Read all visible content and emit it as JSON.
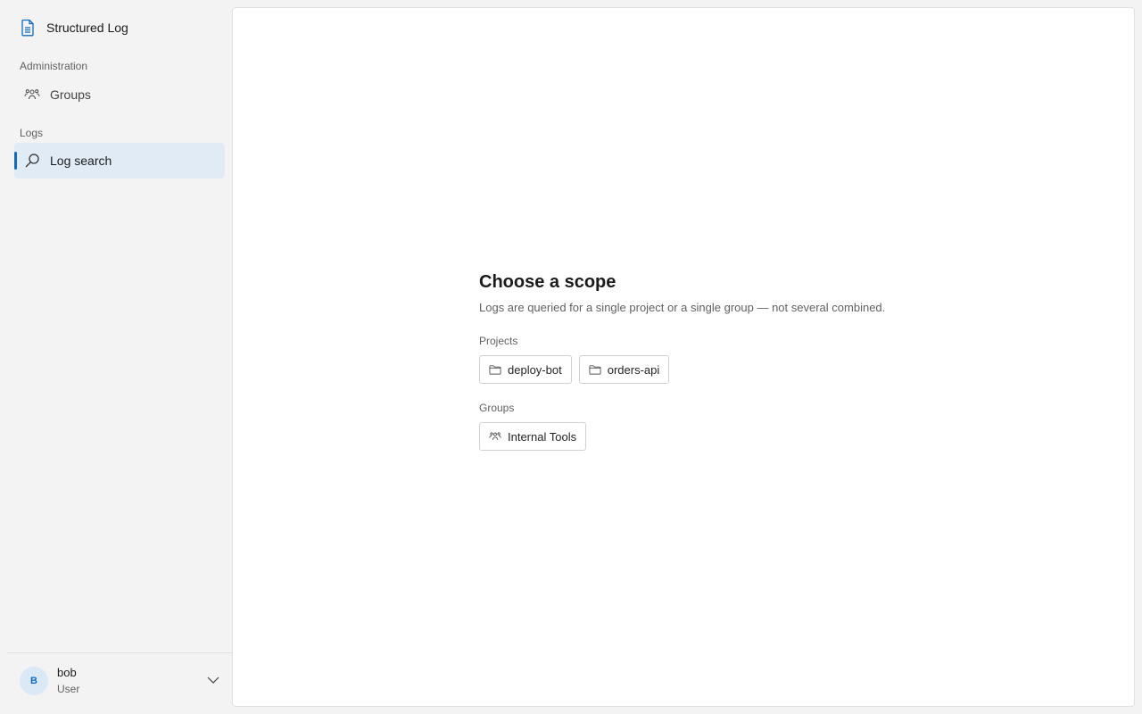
{
  "sidebar": {
    "brand": {
      "title": "Structured Log",
      "icon": "document-icon"
    },
    "sections": [
      {
        "label": "Administration",
        "items": [
          {
            "label": "Groups",
            "icon": "people-icon",
            "active": false
          }
        ]
      },
      {
        "label": "Logs",
        "items": [
          {
            "label": "Log search",
            "icon": "search-icon",
            "active": true
          }
        ]
      }
    ],
    "user": {
      "initial": "B",
      "name": "bob",
      "role": "User"
    }
  },
  "main": {
    "title": "Choose a scope",
    "description": "Logs are queried for a single project or a single group — not several combined.",
    "projects_label": "Projects",
    "projects": [
      {
        "label": "deploy-bot",
        "icon": "folder-icon"
      },
      {
        "label": "orders-api",
        "icon": "folder-icon"
      }
    ],
    "groups_label": "Groups",
    "groups": [
      {
        "label": "Internal Tools",
        "icon": "people-icon"
      }
    ]
  },
  "colors": {
    "accent": "#0f6cbd",
    "active_bg": "#e0ebf6",
    "sidebar_bg": "#f3f3f3"
  }
}
